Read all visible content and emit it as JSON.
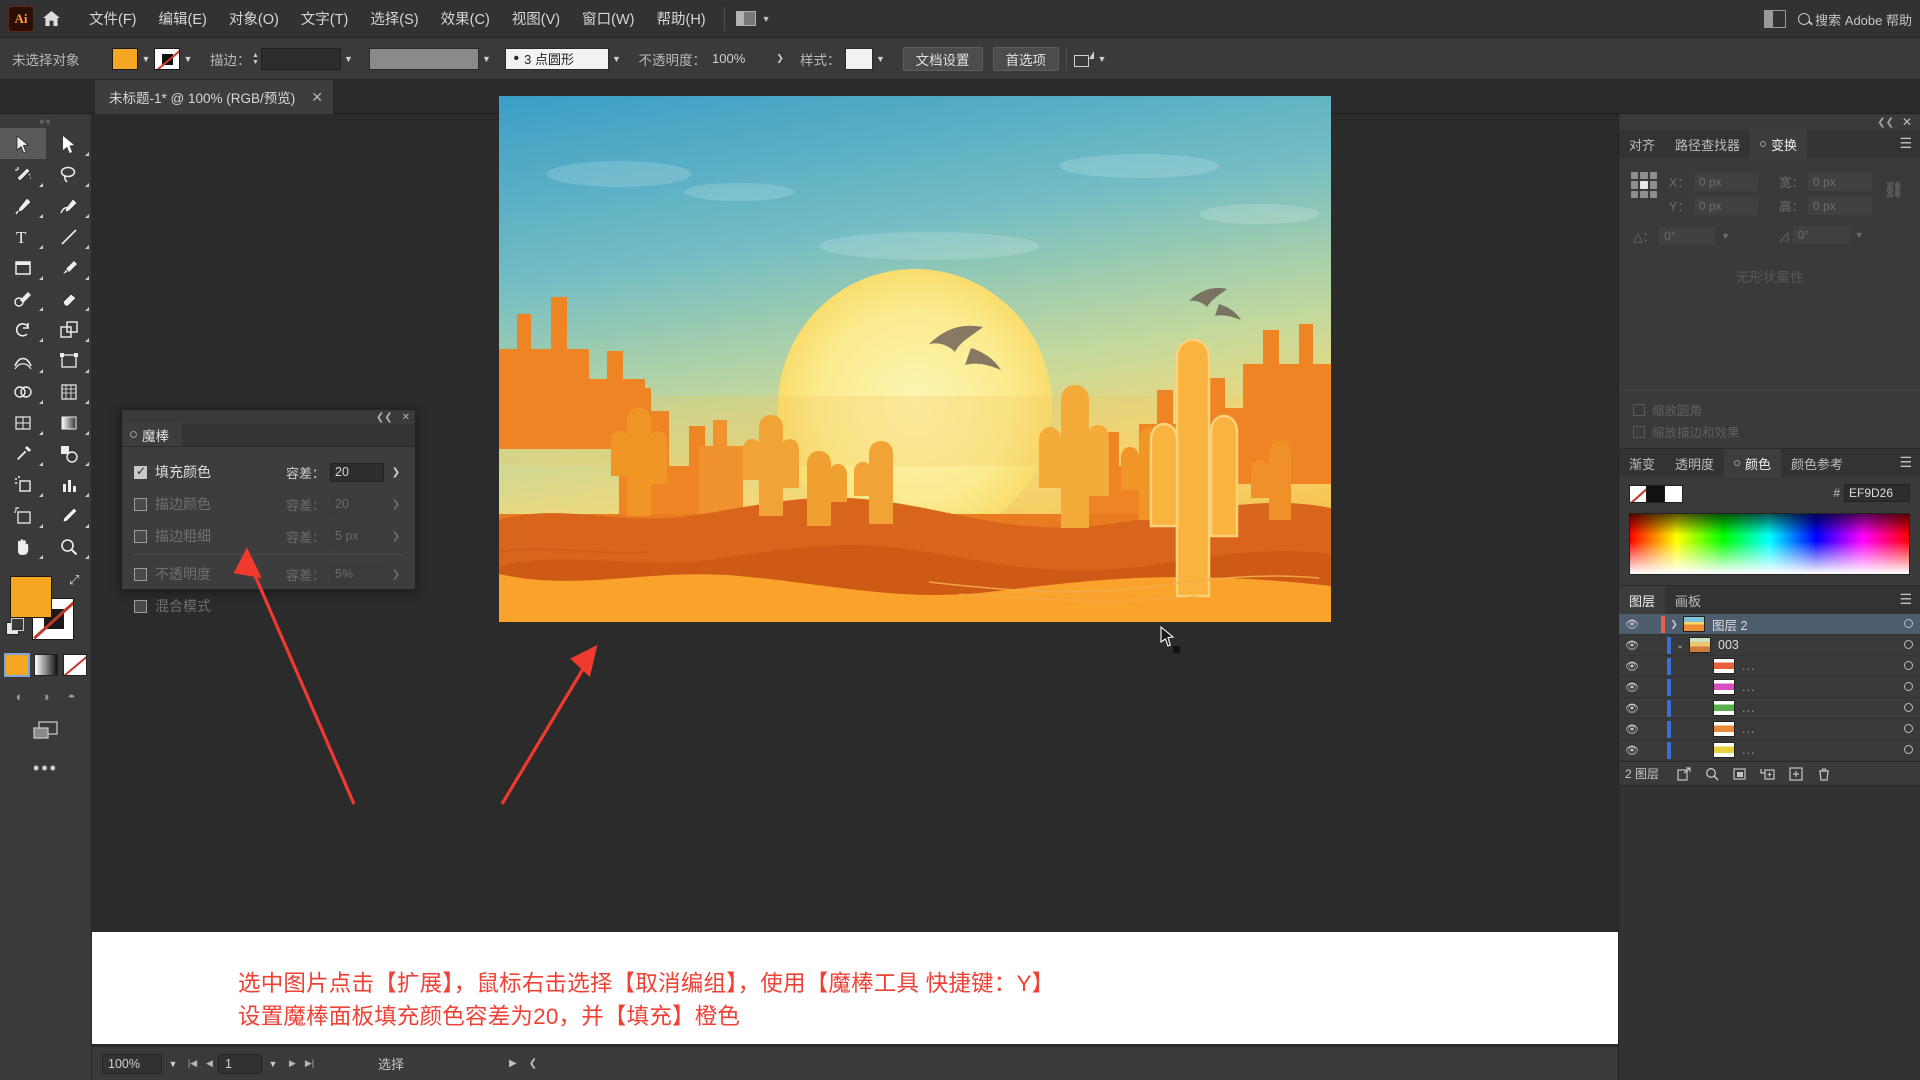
{
  "app": {
    "logo": "Ai",
    "search_placeholder": "搜索 Adobe 帮助"
  },
  "menu": {
    "items": [
      "文件(F)",
      "编辑(E)",
      "对象(O)",
      "文字(T)",
      "选择(S)",
      "效果(C)",
      "视图(V)",
      "窗口(W)",
      "帮助(H)"
    ]
  },
  "controlbar": {
    "selection_label": "未选择对象",
    "stroke_label": "描边：",
    "stroke_weight": "",
    "stroke_profile": "3 点圆形",
    "opacity_label": "不透明度：",
    "opacity_value": "100%",
    "style_label": "样式：",
    "doc_setup": "文档设置",
    "preferences": "首选项",
    "fill_color": "#F5A623"
  },
  "tab": {
    "title": "未标题-1* @ 100% (RGB/预览)",
    "close": "✕"
  },
  "toolbar": {
    "tools": [
      {
        "name": "selection-tool",
        "label": "选择工具"
      },
      {
        "name": "direct-selection-tool",
        "label": "直接选择工具"
      },
      {
        "name": "magic-wand-tool",
        "label": "魔棒工具"
      },
      {
        "name": "lasso-tool",
        "label": "套索工具"
      },
      {
        "name": "pen-tool",
        "label": "钢笔工具"
      },
      {
        "name": "curvature-tool",
        "label": "曲率工具"
      },
      {
        "name": "type-tool",
        "label": "文字工具"
      },
      {
        "name": "line-segment-tool",
        "label": "直线段工具"
      },
      {
        "name": "rectangle-tool",
        "label": "矩形工具"
      },
      {
        "name": "paintbrush-tool",
        "label": "画笔工具"
      },
      {
        "name": "shaper-tool",
        "label": "Shaper工具"
      },
      {
        "name": "eraser-tool",
        "label": "橡皮擦工具"
      },
      {
        "name": "rotate-tool",
        "label": "旋转工具"
      },
      {
        "name": "scale-tool",
        "label": "比例缩放工具"
      },
      {
        "name": "width-tool",
        "label": "宽度工具"
      },
      {
        "name": "free-transform-tool",
        "label": "自由变换工具"
      },
      {
        "name": "shape-builder-tool",
        "label": "形状生成器工具"
      },
      {
        "name": "perspective-grid-tool",
        "label": "透视网格工具"
      },
      {
        "name": "mesh-tool",
        "label": "网格工具"
      },
      {
        "name": "gradient-tool",
        "label": "渐变工具"
      },
      {
        "name": "eyedropper-tool",
        "label": "吸管工具"
      },
      {
        "name": "blend-tool",
        "label": "混合工具"
      },
      {
        "name": "symbol-sprayer-tool",
        "label": "符号喷枪工具"
      },
      {
        "name": "column-graph-tool",
        "label": "柱形图工具"
      },
      {
        "name": "artboard-tool",
        "label": "画板工具"
      },
      {
        "name": "slice-tool",
        "label": "切片工具"
      },
      {
        "name": "hand-tool",
        "label": "抓手工具"
      },
      {
        "name": "zoom-tool",
        "label": "缩放工具"
      }
    ],
    "fill_color": "#F5A623",
    "stroke_color": "#FFFFFF",
    "more_tools": "•••"
  },
  "wand_panel": {
    "title": "魔棒",
    "rows": [
      {
        "label": "填充颜色",
        "checked": true,
        "tol_label": "容差：",
        "tol_value": "20",
        "enabled": true
      },
      {
        "label": "描边颜色",
        "checked": false,
        "tol_label": "容差：",
        "tol_value": "20",
        "enabled": false
      },
      {
        "label": "描边粗细",
        "checked": false,
        "tol_label": "容差：",
        "tol_value": "5 px",
        "enabled": false
      },
      {
        "label": "不透明度",
        "checked": false,
        "tol_label": "容差：",
        "tol_value": "5%",
        "enabled": false
      },
      {
        "label": "混合模式",
        "checked": false,
        "tol_label": "",
        "tol_value": "",
        "enabled": false
      }
    ]
  },
  "transform_panel": {
    "tabs": [
      "对齐",
      "路径查找器",
      "变换"
    ],
    "active_tab": "变换",
    "fields": [
      {
        "label": "X：",
        "value": "0 px"
      },
      {
        "label": "宽：",
        "value": "0 px"
      },
      {
        "label": "Y：",
        "value": "0 px"
      },
      {
        "label": "高：",
        "value": "0 px"
      },
      {
        "label": "△：",
        "value": "0°"
      },
      {
        "label": "",
        "value": "0°"
      }
    ],
    "no_props": "无形状属性",
    "checkboxes": [
      "缩放圆角",
      "缩放描边和效果"
    ]
  },
  "color_panel": {
    "tabs": [
      "渐变",
      "透明度",
      "颜色",
      "颜色参考"
    ],
    "active_tab": "颜色",
    "hex_symbol": "#",
    "hex_value": "EF9D26"
  },
  "layers_panel": {
    "tabs": [
      "图层",
      "画板"
    ],
    "active_tab": "图层",
    "rows": [
      {
        "name": "图层 2",
        "selected": true,
        "expanded": false,
        "indent": 0,
        "thumb": "#e8a23c"
      },
      {
        "name": "003",
        "selected": false,
        "expanded": true,
        "indent": 1,
        "thumb": "#cbd6c0"
      },
      {
        "name": "...",
        "selected": false,
        "indent": 2,
        "thumb": "#e8603c"
      },
      {
        "name": "...",
        "selected": false,
        "indent": 2,
        "thumb": "#d84ec0"
      },
      {
        "name": "...",
        "selected": false,
        "indent": 2,
        "thumb": "#5ab04e"
      },
      {
        "name": "...",
        "selected": false,
        "indent": 2,
        "thumb": "#e88c3c"
      },
      {
        "name": "...",
        "selected": false,
        "indent": 2,
        "thumb": "#e8d23c"
      }
    ],
    "footer_count": "2 图层",
    "footer_icons": [
      "locate-object-icon",
      "search-icon",
      "make-mask-icon",
      "new-sublayer-icon",
      "new-layer-icon",
      "delete-layer-icon"
    ]
  },
  "statusbar": {
    "zoom": "100%",
    "page": "1",
    "status": "选择"
  },
  "annotation": {
    "line1": "选中图片点击【扩展】，鼠标右击选择【取消编组】，使用【魔棒工具 快捷键：Y】",
    "line2": "设置魔棒面板填充颜色容差为20，并【填充】橙色",
    "color": "#EF4136"
  },
  "artwork": {
    "description": "沙漠日落插画：太阳、仙人掌、岩层、飞鸟",
    "sun_color": "#FAF0A0",
    "sky_top": "#3FA3C9",
    "sand_color": "#F6A12A"
  }
}
